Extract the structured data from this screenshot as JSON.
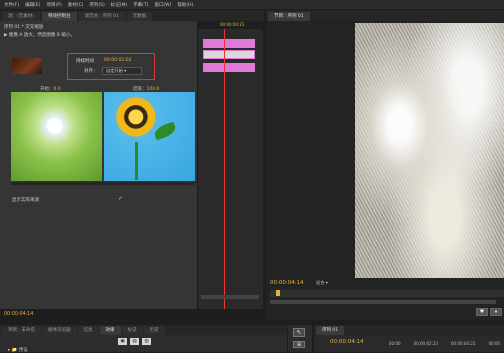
{
  "menubar": [
    "文件(F)",
    "编辑(E)",
    "项目(P)",
    "素材(C)",
    "序列(S)",
    "标记(M)",
    "字幕(T)",
    "窗口(W)",
    "帮助(H)"
  ],
  "left_tabs": [
    "源：(无素材)",
    "特效控制台",
    "调音台：序列 01",
    "元数据"
  ],
  "effect": {
    "sequence_title": "序列 01 * 交叉缩放",
    "effect_path": "图像 A 放大，然后图像 B 缩小。",
    "duration_label": "持续时间",
    "duration_value": "00:00:02:02",
    "align_label": "对齐：",
    "align_value": "自定开始",
    "start_label": "开始：",
    "start_value": "0.0",
    "end_label": "结束：",
    "end_value": "100.0",
    "show_source_label": "显示实际来源",
    "show_source_check": "✓"
  },
  "timeline_strip": {
    "ruler_time": "00:00:04:23"
  },
  "program": {
    "tab_label": "节目：序列 01",
    "timecode": "00:00:04:14",
    "fit_label": "适合"
  },
  "bottom": {
    "timecode": "00:00:04:14",
    "project_tabs": [
      "项目：未命名",
      "媒体浏览器",
      "信息",
      "效果",
      "标记",
      "历史"
    ],
    "project_row": "▸ 📁 预设",
    "sequence_tab": "序列 01",
    "sequence_timecode": "00:00:04:14",
    "ruler_ticks": [
      "00:00",
      "00:00:02:23",
      "00:00:04:23",
      "00:00"
    ]
  },
  "colors": {
    "accent_timecode": "#e8b13a",
    "clip": "#e07ad6",
    "playhead": "#e33333",
    "highlight_box": "#d23c3c"
  }
}
